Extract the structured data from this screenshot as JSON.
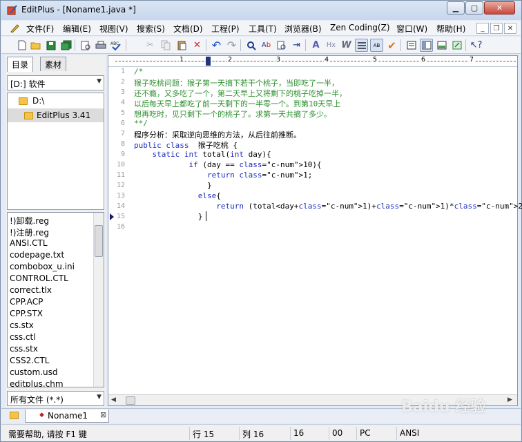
{
  "window": {
    "title": "EditPlus - [Noname1.java *]"
  },
  "menu": {
    "items": [
      "文件(F)",
      "编辑(E)",
      "视图(V)",
      "搜索(S)",
      "文档(D)",
      "工程(P)",
      "工具(T)",
      "浏览器(B)",
      "Zen Coding(Z)",
      "窗口(W)",
      "帮助(H)"
    ]
  },
  "toolbar": {
    "icons": [
      "new-file-icon",
      "open-folder-icon",
      "save-icon",
      "save-all-icon",
      "print-preview-icon",
      "print-icon",
      "spell-check-icon",
      "cut-icon",
      "copy-icon",
      "paste-icon",
      "delete-icon",
      "undo-icon",
      "redo-icon",
      "find-icon",
      "replace-icon",
      "find-in-files-icon",
      "goto-icon",
      "indent-icon",
      "font-icon",
      "hex-icon",
      "word-wrap-icon",
      "line-number-icon",
      "column-select-icon",
      "check-icon",
      "output-window-icon",
      "directory-window-icon",
      "cliptext-window-icon",
      "fullscreen-icon",
      "help-pointer-icon"
    ]
  },
  "panel": {
    "tabs": [
      "目录",
      "素材"
    ],
    "drive": "[D:] 软件",
    "tree": [
      "D:\\",
      "EditPlus 3.41"
    ],
    "files": [
      "!)卸载.reg",
      "!)注册.reg",
      "ANSI.CTL",
      "codepage.txt",
      "combobox_u.ini",
      "CONTROL.CTL",
      "correct.tlx",
      "CPP.ACP",
      "CPP.STX",
      "cs.stx",
      "css.ctl",
      "css.stx",
      "CSS2.CTL",
      "custom.usd",
      "editplus.chm"
    ],
    "filter": "所有文件 (*.*)"
  },
  "ruler": {
    "numbers": [
      "1",
      "2",
      "3",
      "4",
      "5",
      "6",
      "7"
    ]
  },
  "code": {
    "lines": [
      {
        "n": "1",
        "text": "/*",
        "cls": "c-comment"
      },
      {
        "n": "2",
        "text": "猴子吃桃问题：猴子第一天摘下若干个桃子，当即吃了一半，",
        "cls": "c-comment"
      },
      {
        "n": "3",
        "text": "还不瘾，又多吃了一个，第二天早上又将剩下的桃子吃掉一半，",
        "cls": "c-comment"
      },
      {
        "n": "4",
        "text": "以后每天早上都吃了前一天剩下的一半零一个。到第10天早上",
        "cls": "c-comment"
      },
      {
        "n": "5",
        "text": "想再吃时，见只剩下一个的桃子了。求第一天共摘了多少。",
        "cls": "c-comment"
      },
      {
        "n": "6",
        "text": "**/",
        "cls": "c-comment"
      },
      {
        "n": "7",
        "text": "程序分析：采取逆向思维的方法，从后往前推断。",
        "cls": "c-text"
      },
      {
        "n": "8",
        "text": "public class  猴子吃桃 {",
        "cls": "c-kw"
      },
      {
        "n": "9",
        "text": "    static int total(int day){",
        "cls": "c-kw"
      },
      {
        "n": "10",
        "text": "            if (day == 10){",
        "cls": "c-kw"
      },
      {
        "n": "11",
        "text": "                return 1;",
        "cls": "c-kw"
      },
      {
        "n": "12",
        "text": "                }",
        "cls": "c-kw"
      },
      {
        "n": "13",
        "text": "              else{",
        "cls": "c-kw"
      },
      {
        "n": "14",
        "text": "                  return (total<day+1)+1)*2;",
        "cls": "c-kw"
      },
      {
        "n": "15",
        "text": "              }",
        "cls": "c-kw"
      },
      {
        "n": "16",
        "text": "",
        "cls": "c-text"
      }
    ]
  },
  "doc_tab": {
    "label": "Noname1"
  },
  "status": {
    "help": "需要帮助, 请按 F1 键",
    "line": "行 15",
    "col": "列 16",
    "num": "16",
    "code": "00",
    "platform": "PC",
    "encoding": "ANSI"
  },
  "watermark": "Baidu 经验"
}
